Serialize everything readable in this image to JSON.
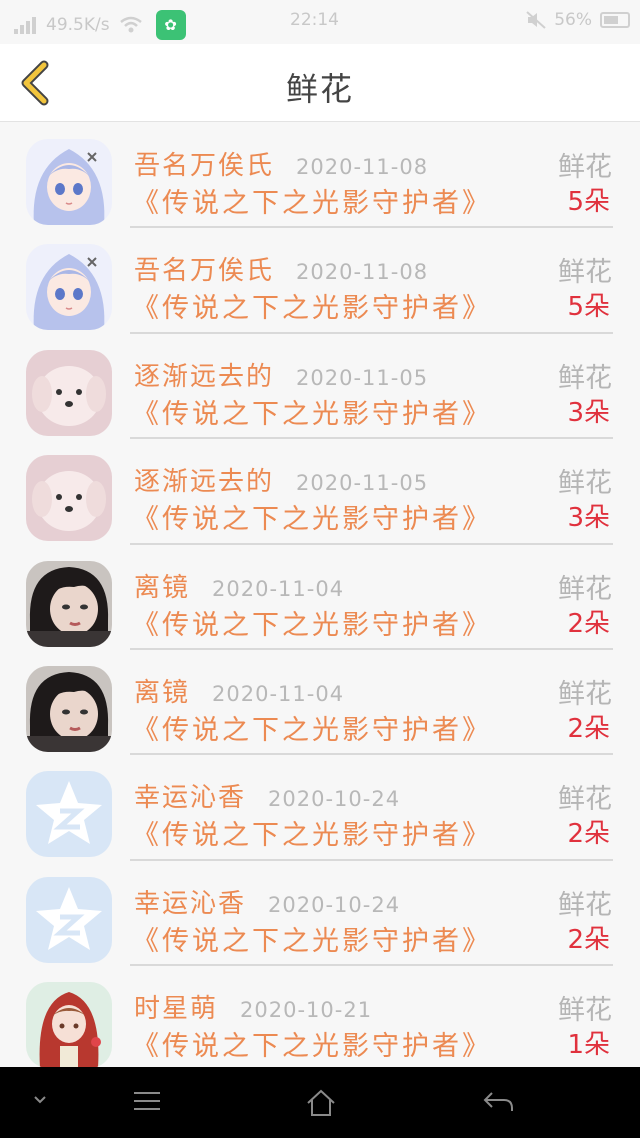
{
  "status": {
    "net_speed": "49.5K/s",
    "time": "22:14",
    "battery": "56%"
  },
  "header": {
    "title": "鲜花"
  },
  "rows": [
    {
      "name": "吾名万俟氏",
      "date": "2020-11-08",
      "book": "《传说之下之光影守护者》",
      "label": "鲜花",
      "count": "5朵",
      "avatar": "anime-girl"
    },
    {
      "name": "吾名万俟氏",
      "date": "2020-11-08",
      "book": "《传说之下之光影守护者》",
      "label": "鲜花",
      "count": "5朵",
      "avatar": "anime-girl"
    },
    {
      "name": "逐渐远去的",
      "date": "2020-11-05",
      "book": "《传说之下之光影守护者》",
      "label": "鲜花",
      "count": "3朵",
      "avatar": "white-dog"
    },
    {
      "name": "逐渐远去的",
      "date": "2020-11-05",
      "book": "《传说之下之光影守护者》",
      "label": "鲜花",
      "count": "3朵",
      "avatar": "white-dog"
    },
    {
      "name": "离镜",
      "date": "2020-11-04",
      "book": "《传说之下之光影守护者》",
      "label": "鲜花",
      "count": "2朵",
      "avatar": "dark-hair"
    },
    {
      "name": "离镜",
      "date": "2020-11-04",
      "book": "《传说之下之光影守护者》",
      "label": "鲜花",
      "count": "2朵",
      "avatar": "dark-hair"
    },
    {
      "name": "幸运沁香",
      "date": "2020-10-24",
      "book": "《传说之下之光影守护者》",
      "label": "鲜花",
      "count": "2朵",
      "avatar": "qzone-star"
    },
    {
      "name": "幸运沁香",
      "date": "2020-10-24",
      "book": "《传说之下之光影守护者》",
      "label": "鲜花",
      "count": "2朵",
      "avatar": "qzone-star"
    },
    {
      "name": "时星萌",
      "date": "2020-10-21",
      "book": "《传说之下之光影守护者》",
      "label": "鲜花",
      "count": "1朵",
      "avatar": "red-hood"
    }
  ],
  "icons": {
    "back": "back-chevron-icon",
    "nav": [
      "chevron-down-icon",
      "menu-icon",
      "home-icon",
      "return-icon"
    ]
  },
  "colors": {
    "accent": "#ec8a52",
    "count_red": "#e0313d",
    "back_chevron": "#f2c53d",
    "muted": "#b5b5b5"
  }
}
